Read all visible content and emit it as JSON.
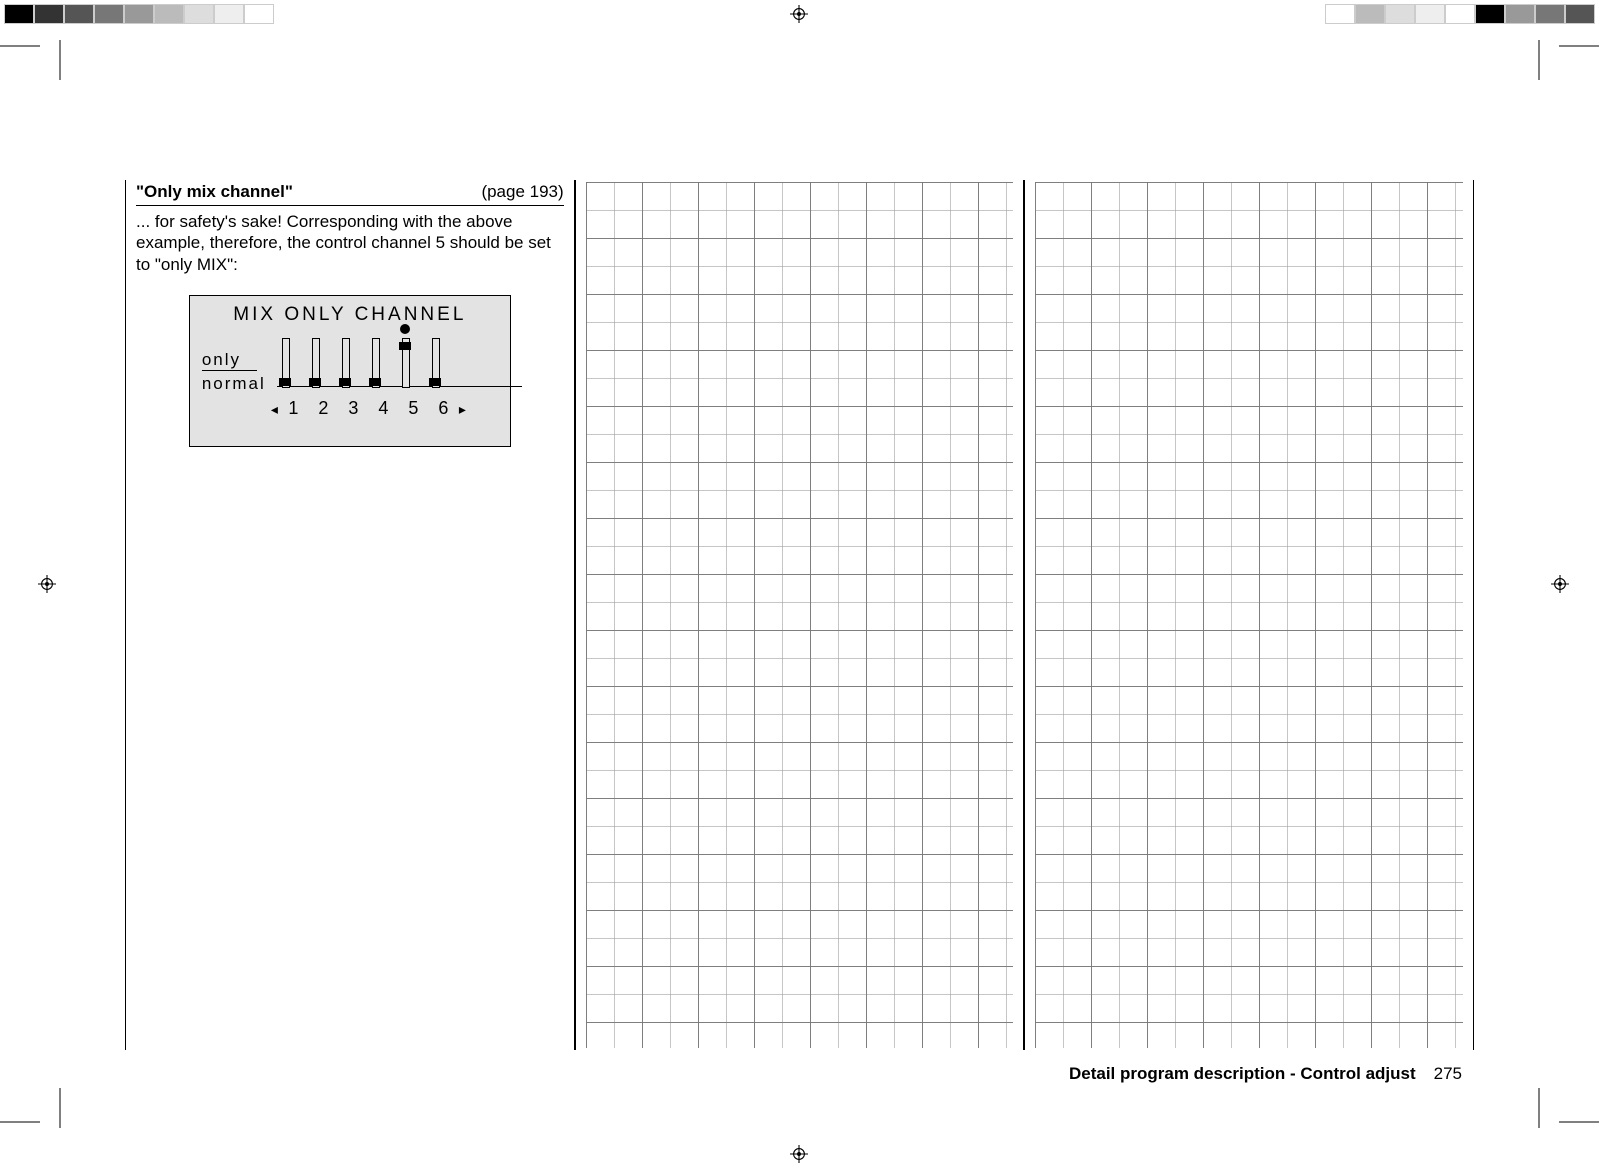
{
  "header": {
    "title": "\"Only mix channel\"",
    "page_ref": "(page 193)"
  },
  "body_text": "... for safety's sake! Corresponding with the above example, therefore, the control channel 5 should be set to \"only MIX\":",
  "mix_panel": {
    "title": "MIX  ONLY  CHANNEL",
    "row_only": "only",
    "row_normal": "normal",
    "channels": [
      "1",
      "2",
      "3",
      "4",
      "5",
      "6"
    ],
    "left_arrow": "◂",
    "right_arrow": "▸",
    "positions": [
      "normal",
      "normal",
      "normal",
      "normal",
      "only",
      "normal"
    ]
  },
  "footer": {
    "section": "Detail program description - Control adjust",
    "page_num": "275"
  }
}
